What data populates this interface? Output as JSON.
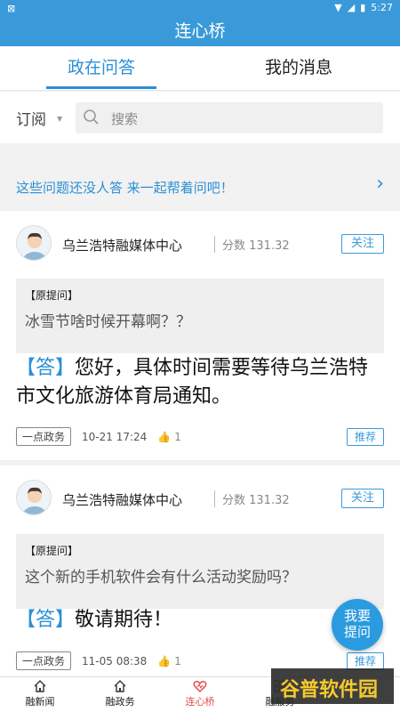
{
  "status": {
    "time": "5:27"
  },
  "header": {
    "title": "连心桥"
  },
  "tabs": [
    {
      "label": "政在问答"
    },
    {
      "label": "我的消息"
    }
  ],
  "filter": {
    "subscribe_label": "订阅",
    "search_placeholder": "搜索"
  },
  "banner": {
    "text": "这些问题还没人答 来一起帮着问吧！"
  },
  "posts": [
    {
      "org": "乌兰浩特融媒体中心",
      "score": "分数 131.32",
      "follow": "关注",
      "quote_label": "【原提问】",
      "question": "冰雪节啥时候开幕啊？？",
      "answer_tag": "【答】",
      "answer": "您好，具体时间需要等待乌兰浩特市文化旅游体育局通知。",
      "category": "一点政务",
      "date": "10-21 17:24",
      "likes": "1",
      "recommend": "推荐"
    },
    {
      "org": "乌兰浩特融媒体中心",
      "score": "分数 131.32",
      "follow": "关注",
      "quote_label": "【原提问】",
      "question": "这个新的手机软件会有什么活动奖励吗？",
      "answer_tag": "【答】",
      "answer": "敬请期待！",
      "category": "一点政务",
      "date": "11-05 08:38",
      "likes": "1",
      "recommend": "推荐"
    }
  ],
  "fab": {
    "line1": "我要",
    "line2": "提问"
  },
  "nav": [
    {
      "label": "融新闻",
      "icon": "home-icon"
    },
    {
      "label": "融政务",
      "icon": "home-icon"
    },
    {
      "label": "连心桥",
      "icon": "heart-icon"
    },
    {
      "label": "融服务",
      "icon": "grid-icon"
    }
  ],
  "watermark": {
    "text": "谷普软件园"
  },
  "colors": {
    "primary": "#3a9ad9",
    "accent": "#2a8fd6",
    "active_nav": "#e34a4a"
  }
}
